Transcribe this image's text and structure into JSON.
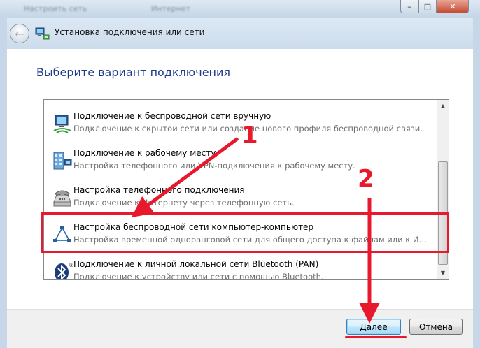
{
  "window": {
    "title": "Установка подключения или сети",
    "background_text_1": "Настроить сеть",
    "background_text_2": "Интернет",
    "minimize": "–",
    "maximize": "□",
    "close": "✕"
  },
  "instruction": "Выберите вариант подключения",
  "options": [
    {
      "icon": "wireless-network-icon",
      "title": "Подключение к беспроводной сети вручную",
      "description": "Подключение к скрытой сети или создание нового профиля беспроводной связи."
    },
    {
      "icon": "workplace-icon",
      "title": "Подключение к рабочему месту",
      "description": "Настройка телефонного или VPN-подключения к рабочему месту."
    },
    {
      "icon": "telephone-icon",
      "title": "Настройка телефонного подключения",
      "description": "Подключение к Интернету через телефонную сеть."
    },
    {
      "icon": "adhoc-network-icon",
      "title": "Настройка беспроводной сети компьютер-компьютер",
      "description": "Настройка временной одноранговой сети для общего доступа к файлам или к Инт..."
    },
    {
      "icon": "bluetooth-icon",
      "title": "Подключение к личной локальной сети Bluetooth (PAN)",
      "description": "Подключение к устройству или сети с помощью Bluetooth."
    }
  ],
  "buttons": {
    "next": "Далее",
    "cancel": "Отмена"
  },
  "annotations": {
    "marker_1": "1",
    "marker_2": "2",
    "color": "#e8192c"
  }
}
